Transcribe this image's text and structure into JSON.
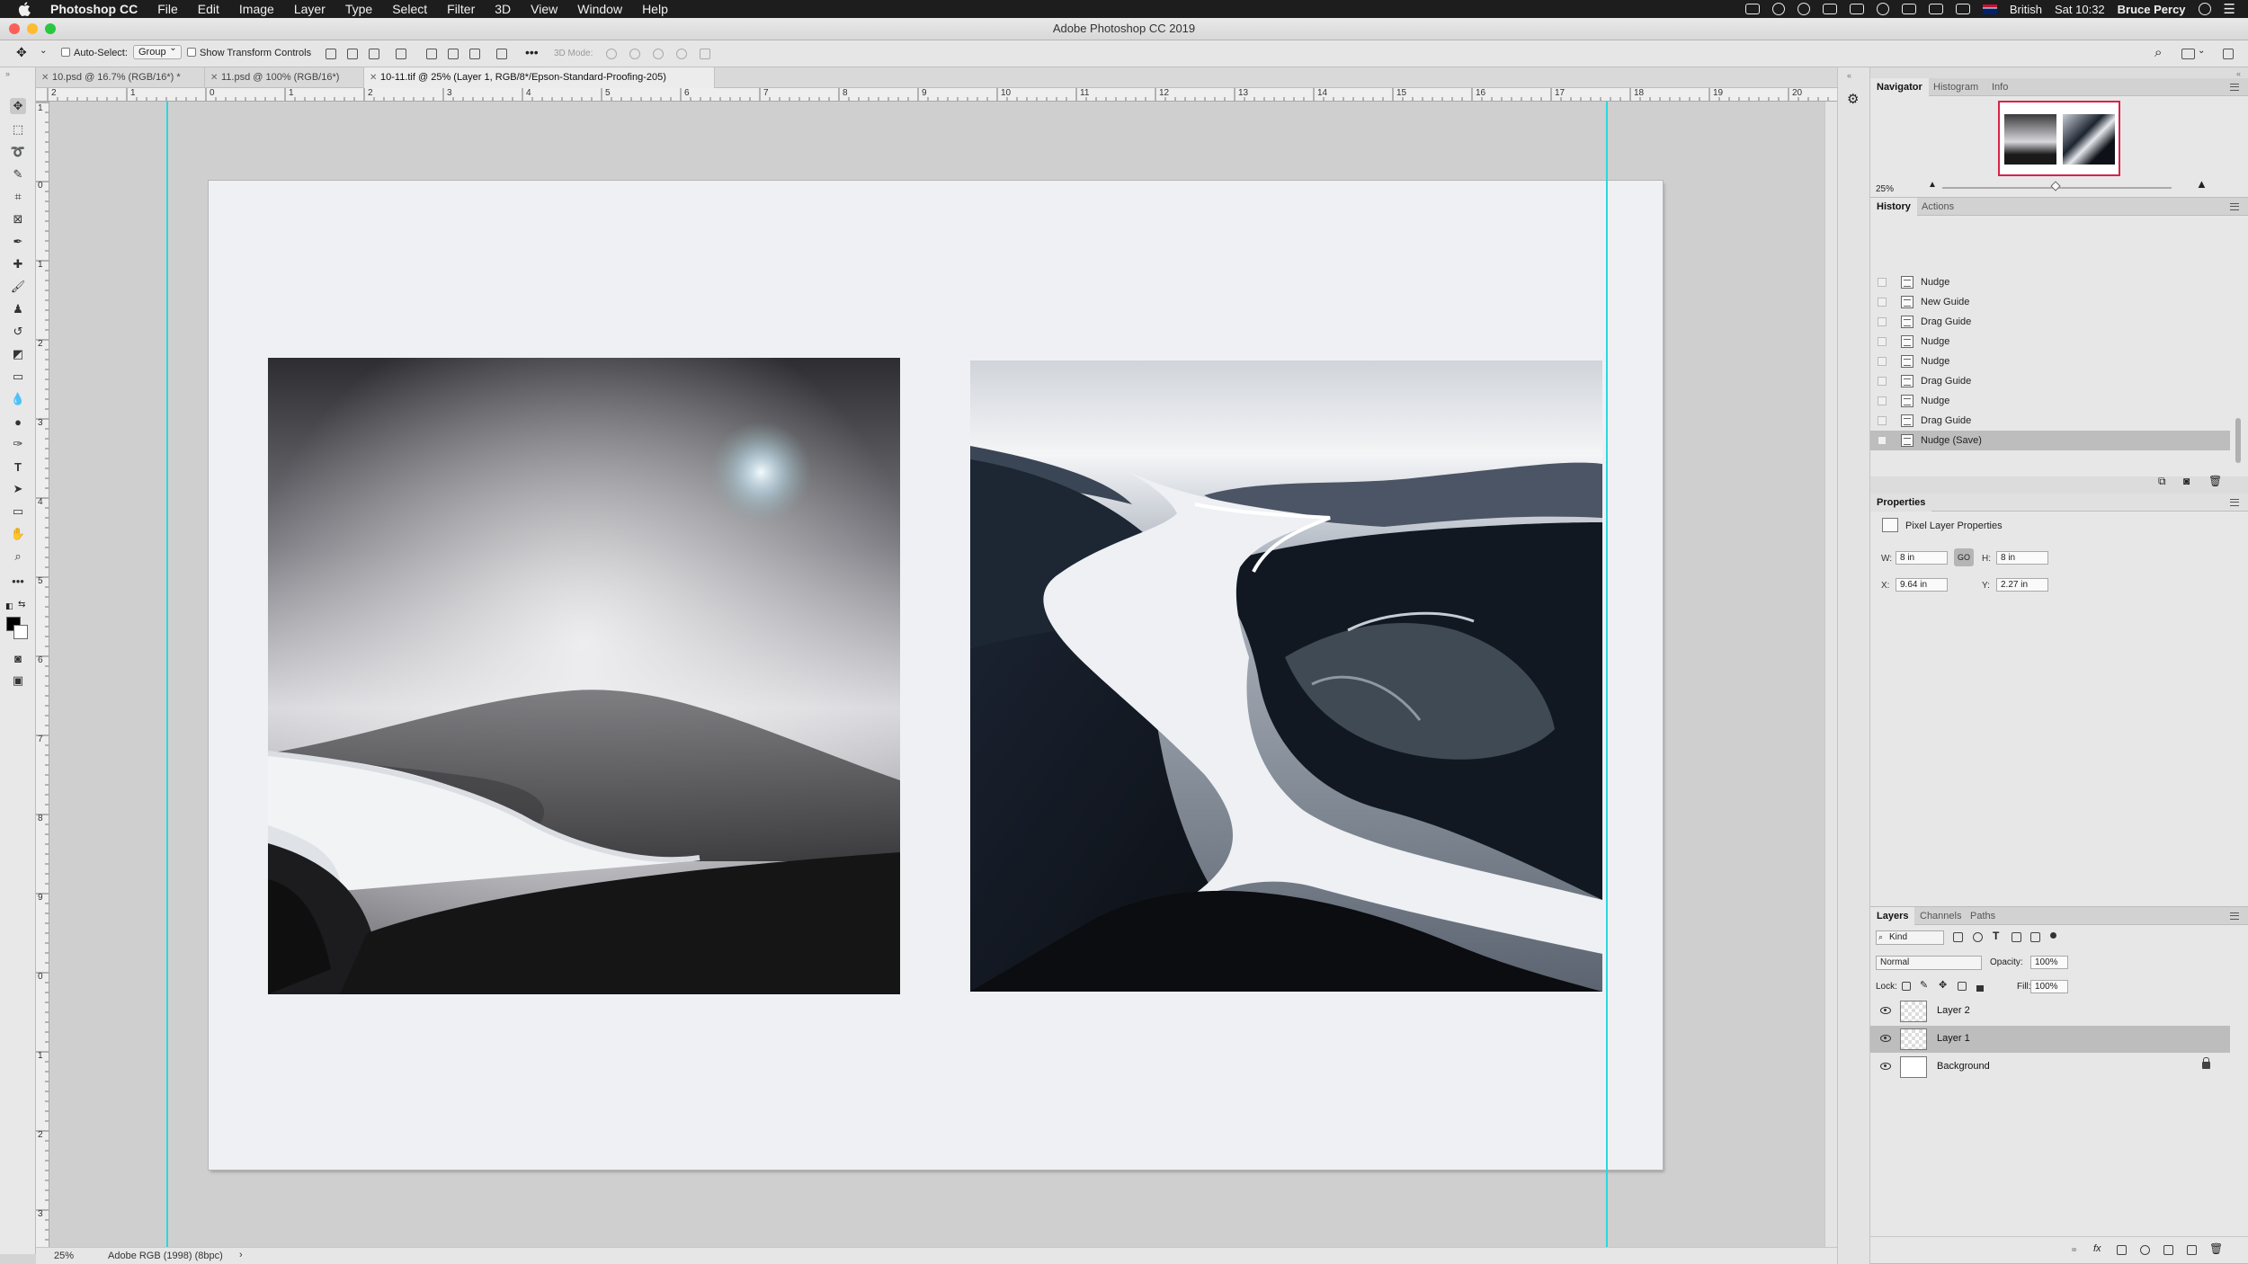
{
  "menubar": {
    "app_name": "Photoshop CC",
    "items": [
      "File",
      "Edit",
      "Image",
      "Layer",
      "Type",
      "Select",
      "Filter",
      "3D",
      "View",
      "Window",
      "Help"
    ],
    "keyboard": "British",
    "clock": "Sat 10:32",
    "user": "Bruce Percy"
  },
  "window": {
    "title": "Adobe Photoshop CC 2019"
  },
  "options": {
    "auto_select_label": "Auto-Select:",
    "auto_select_value": "Group",
    "transform_label": "Show Transform Controls",
    "mode3d_label": "3D Mode:",
    "more": "•••"
  },
  "tabs": [
    {
      "label": "10.psd @ 16.7% (RGB/16*) *"
    },
    {
      "label": "11.psd @ 100% (RGB/16*)"
    },
    {
      "label": "10-11.tif @ 25% (Layer 1, RGB/8*/Epson-Standard-Proofing-205)"
    }
  ],
  "ruler": {
    "h_labels": [
      "2",
      "1",
      "0",
      "1",
      "2",
      "3",
      "4",
      "5",
      "6",
      "7",
      "8",
      "9",
      "10",
      "11",
      "12",
      "13",
      "14",
      "15",
      "16",
      "17",
      "18",
      "19",
      "20"
    ],
    "v_labels": [
      "1",
      "0",
      "1",
      "2",
      "3",
      "4",
      "5",
      "6",
      "7",
      "8",
      "9",
      "0",
      "1",
      "2",
      "3"
    ]
  },
  "status": {
    "zoom": "25%",
    "profile": "Adobe RGB (1998) (8bpc)",
    "arrow": "›"
  },
  "navigator": {
    "tabs": [
      "Navigator",
      "Histogram",
      "Info"
    ],
    "zoom": "25%"
  },
  "history": {
    "tabs": [
      "History",
      "Actions"
    ],
    "items": [
      {
        "label": "Nudge",
        "selected": false
      },
      {
        "label": "New Guide",
        "selected": false
      },
      {
        "label": "Drag Guide",
        "selected": false
      },
      {
        "label": "Nudge",
        "selected": false
      },
      {
        "label": "Nudge",
        "selected": false
      },
      {
        "label": "Drag Guide",
        "selected": false
      },
      {
        "label": "Nudge",
        "selected": false
      },
      {
        "label": "Drag Guide",
        "selected": false
      },
      {
        "label": "Nudge (Save)",
        "selected": true
      }
    ]
  },
  "properties": {
    "title": "Properties",
    "type_label": "Pixel Layer Properties",
    "w_label": "W:",
    "w_value": "8 in",
    "h_label": "H:",
    "h_value": "8 in",
    "link_label": "GO",
    "x_label": "X:",
    "x_value": "9.64 in",
    "y_label": "Y:",
    "y_value": "2.27 in"
  },
  "layers": {
    "tabs": [
      "Layers",
      "Channels",
      "Paths"
    ],
    "filter_value": "Kind",
    "blend_mode": "Normal",
    "opacity_label": "Opacity:",
    "opacity_value": "100%",
    "lock_label": "Lock:",
    "fill_label": "Fill:",
    "fill_value": "100%",
    "items": [
      {
        "name": "Layer 2",
        "selected": false
      },
      {
        "name": "Layer 1",
        "selected": true
      },
      {
        "name": "Background",
        "selected": false
      }
    ],
    "footer_icons": [
      "link-icon",
      "fx-icon",
      "mask-icon",
      "adjustment-icon",
      "group-icon",
      "new-layer-icon",
      "trash-icon"
    ]
  },
  "colors": {
    "guide": "#29d8e0",
    "navigator_frame": "#d9224b",
    "panel_bg": "#e7e7e7",
    "selection": "#bdbdbd"
  }
}
